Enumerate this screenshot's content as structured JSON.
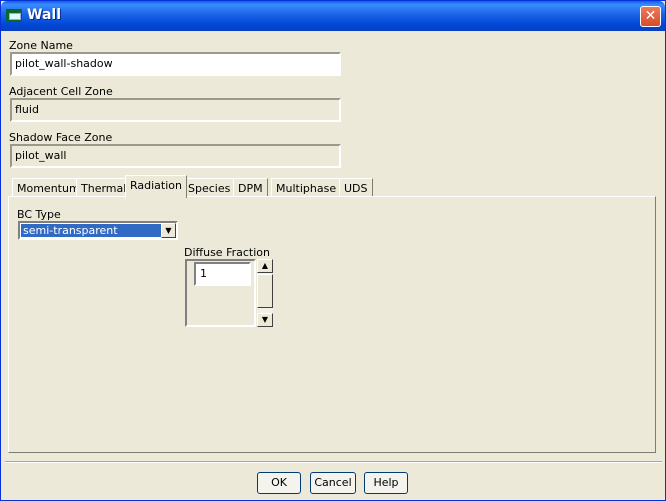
{
  "window": {
    "title": "Wall",
    "close_glyph": "✕",
    "icon": "fluent-app-icon"
  },
  "form": {
    "zone_name": {
      "label": "Zone Name",
      "value": "pilot_wall-shadow"
    },
    "adjacent_cell_zone": {
      "label": "Adjacent Cell Zone",
      "value": "fluid"
    },
    "shadow_face_zone": {
      "label": "Shadow Face Zone",
      "value": "pilot_wall"
    }
  },
  "tabs": [
    {
      "label": "Momentum"
    },
    {
      "label": "Thermal"
    },
    {
      "label": "Radiation",
      "active": true
    },
    {
      "label": "Species"
    },
    {
      "label": "DPM"
    },
    {
      "label": "Multiphase"
    },
    {
      "label": "UDS"
    }
  ],
  "radiation": {
    "bc_type": {
      "label": "BC Type",
      "value": "semi-transparent"
    },
    "diffuse_fraction": {
      "label": "Diffuse Fraction",
      "value": "1"
    }
  },
  "buttons": {
    "ok": "OK",
    "cancel": "Cancel",
    "help": "Help"
  },
  "colors": {
    "titlebar": "#0a5fea",
    "dialog_bg": "#ece9d8",
    "selection": "#316ac5",
    "close": "#d74c2b"
  }
}
